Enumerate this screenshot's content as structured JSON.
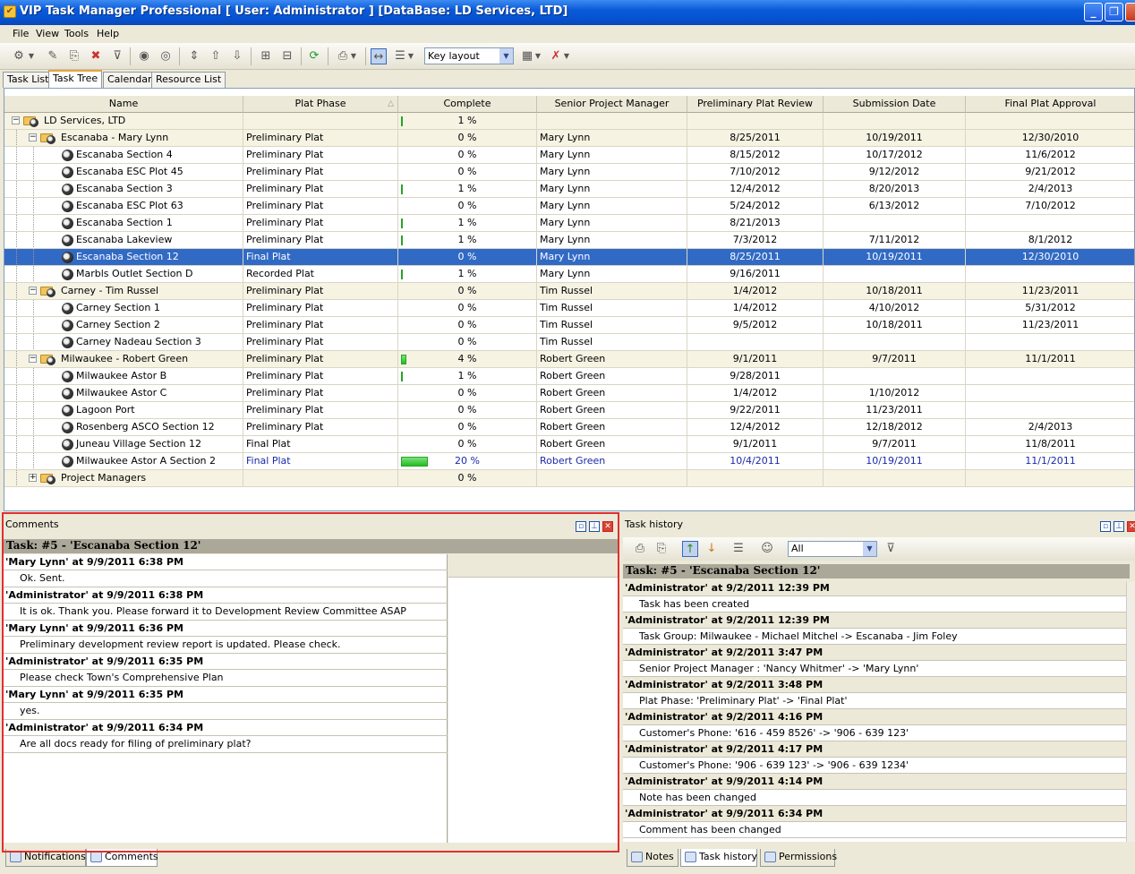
{
  "window": {
    "title": "VIP Task Manager Professional [ User: Administrator ] [DataBase: LD Services, LTD]"
  },
  "menu": [
    "File",
    "View",
    "Tools",
    "Help"
  ],
  "toolbar": {
    "layout_value": "Key layout"
  },
  "tabs": [
    "Task List",
    "Task Tree",
    "Calendar",
    "Resource List"
  ],
  "active_tab": "Task Tree",
  "grid": {
    "columns": [
      "Name",
      "Plat Phase",
      "Complete",
      "Senior Project Manager",
      "Preliminary Plat Review",
      "Submission Date",
      "Final Plat Approval"
    ],
    "rows": [
      {
        "level": 0,
        "type": "group",
        "expanded": true,
        "name": "LD Services, LTD",
        "phase": "",
        "complete": "1 %",
        "progress": 0.01,
        "manager": "",
        "review": "",
        "submission": "",
        "approval": ""
      },
      {
        "level": 1,
        "type": "group",
        "expanded": true,
        "name": "Escanaba - Mary Lynn",
        "phase": "Preliminary Plat",
        "complete": "0 %",
        "progress": 0,
        "manager": "Mary Lynn",
        "review": "8/25/2011",
        "submission": "10/19/2011",
        "approval": "12/30/2010"
      },
      {
        "level": 2,
        "type": "task",
        "name": "Escanaba Section 4",
        "phase": "Preliminary Plat",
        "complete": "0 %",
        "progress": 0,
        "manager": "Mary Lynn",
        "review": "8/15/2012",
        "submission": "10/17/2012",
        "approval": "11/6/2012"
      },
      {
        "level": 2,
        "type": "task",
        "name": "Escanaba ESC Plot 45",
        "phase": "Preliminary Plat",
        "complete": "0 %",
        "progress": 0,
        "manager": "Mary Lynn",
        "review": "7/10/2012",
        "submission": "9/12/2012",
        "approval": "9/21/2012"
      },
      {
        "level": 2,
        "type": "task",
        "name": "Escanaba Section 3",
        "phase": "Preliminary Plat",
        "complete": "1 %",
        "progress": 0.01,
        "manager": "Mary Lynn",
        "review": "12/4/2012",
        "submission": "8/20/2013",
        "approval": "2/4/2013"
      },
      {
        "level": 2,
        "type": "task",
        "name": "Escanaba ESC Plot 63",
        "phase": "Preliminary Plat",
        "complete": "0 %",
        "progress": 0,
        "manager": "Mary Lynn",
        "review": "5/24/2012",
        "submission": "6/13/2012",
        "approval": "7/10/2012"
      },
      {
        "level": 2,
        "type": "task",
        "name": "Escanaba Section 1",
        "phase": "Preliminary Plat",
        "complete": "1 %",
        "progress": 0.01,
        "manager": "Mary Lynn",
        "review": "8/21/2013",
        "submission": "",
        "approval": ""
      },
      {
        "level": 2,
        "type": "task",
        "name": "Escanaba Lakeview",
        "phase": "Preliminary Plat",
        "complete": "1 %",
        "progress": 0.01,
        "manager": "Mary Lynn",
        "review": "7/3/2012",
        "submission": "7/11/2012",
        "approval": "8/1/2012"
      },
      {
        "level": 2,
        "type": "task",
        "selected": true,
        "name": "Escanaba Section 12",
        "phase": "Final Plat",
        "complete": "0 %",
        "progress": 0,
        "manager": "Mary Lynn",
        "review": "8/25/2011",
        "submission": "10/19/2011",
        "approval": "12/30/2010"
      },
      {
        "level": 2,
        "type": "task",
        "name": "Marbls Outlet Section D",
        "phase": "Recorded Plat",
        "complete": "1 %",
        "progress": 0.01,
        "manager": "Mary Lynn",
        "review": "9/16/2011",
        "submission": "",
        "approval": ""
      },
      {
        "level": 1,
        "type": "group",
        "expanded": true,
        "name": "Carney - Tim Russel",
        "phase": "Preliminary Plat",
        "complete": "0 %",
        "progress": 0,
        "manager": "Tim Russel",
        "review": "1/4/2012",
        "submission": "10/18/2011",
        "approval": "11/23/2011"
      },
      {
        "level": 2,
        "type": "task",
        "name": "Carney Section 1",
        "phase": "Preliminary Plat",
        "complete": "0 %",
        "progress": 0,
        "manager": "Tim Russel",
        "review": "1/4/2012",
        "submission": "4/10/2012",
        "approval": "5/31/2012"
      },
      {
        "level": 2,
        "type": "task",
        "name": "Carney Section 2",
        "phase": "Preliminary Plat",
        "complete": "0 %",
        "progress": 0,
        "manager": "Tim Russel",
        "review": "9/5/2012",
        "submission": "10/18/2011",
        "approval": "11/23/2011"
      },
      {
        "level": 2,
        "type": "task",
        "name": "Carney Nadeau Section 3",
        "phase": "Preliminary Plat",
        "complete": "0 %",
        "progress": 0,
        "manager": "Tim Russel",
        "review": "",
        "submission": "",
        "approval": ""
      },
      {
        "level": 1,
        "type": "group",
        "expanded": true,
        "name": "Milwaukee - Robert Green",
        "phase": "Preliminary Plat",
        "complete": "4 %",
        "progress": 0.04,
        "manager": "Robert Green",
        "review": "9/1/2011",
        "submission": "9/7/2011",
        "approval": "11/1/2011"
      },
      {
        "level": 2,
        "type": "task",
        "name": "Milwaukee Astor B",
        "phase": "Preliminary Plat",
        "complete": "1 %",
        "progress": 0.01,
        "manager": "Robert Green",
        "review": "9/28/2011",
        "submission": "",
        "approval": ""
      },
      {
        "level": 2,
        "type": "task",
        "name": "Milwaukee Astor C",
        "phase": "Preliminary Plat",
        "complete": "0 %",
        "progress": 0,
        "manager": "Robert Green",
        "review": "1/4/2012",
        "submission": "1/10/2012",
        "approval": ""
      },
      {
        "level": 2,
        "type": "task",
        "name": "Lagoon Port",
        "phase": "Preliminary Plat",
        "complete": "0 %",
        "progress": 0,
        "manager": "Robert Green",
        "review": "9/22/2011",
        "submission": "11/23/2011",
        "approval": ""
      },
      {
        "level": 2,
        "type": "task",
        "name": "Rosenberg ASCO Section 12",
        "phase": "Preliminary Plat",
        "complete": "0 %",
        "progress": 0,
        "manager": "Robert Green",
        "review": "12/4/2012",
        "submission": "12/18/2012",
        "approval": "2/4/2013"
      },
      {
        "level": 2,
        "type": "task",
        "name": "Juneau Village Section 12",
        "phase": "Final Plat",
        "complete": "0 %",
        "progress": 0,
        "manager": "Robert Green",
        "review": "9/1/2011",
        "submission": "9/7/2011",
        "approval": "11/8/2011"
      },
      {
        "level": 2,
        "type": "task",
        "highlight": true,
        "name": "Milwaukee  Astor A Section 2",
        "phase": "Final Plat",
        "complete": "20 %",
        "progress": 0.2,
        "manager": "Robert Green",
        "review": "10/4/2011",
        "submission": "10/19/2011",
        "approval": "11/1/2011"
      },
      {
        "level": 1,
        "type": "group",
        "expanded": false,
        "name": "Project Managers",
        "phase": "",
        "complete": "0 %",
        "progress": 0,
        "manager": "",
        "review": "",
        "submission": "",
        "approval": ""
      }
    ]
  },
  "comments": {
    "title": "Comments",
    "task_header": "Task: #5 - 'Escanaba Section 12'",
    "entries": [
      {
        "head": "'Mary Lynn' at 9/9/2011 6:38 PM",
        "body": "Ok. Sent."
      },
      {
        "head": "'Administrator' at 9/9/2011 6:38 PM",
        "body": "It is ok. Thank you. Please forward it to Development Review Committee ASAP"
      },
      {
        "head": "'Mary Lynn' at 9/9/2011 6:36 PM",
        "body": "Preliminary development review report is updated. Please check."
      },
      {
        "head": "'Administrator' at 9/9/2011 6:35 PM",
        "body": "Please check Town's Comprehensive Plan"
      },
      {
        "head": "'Mary Lynn' at 9/9/2011 6:35 PM",
        "body": "yes."
      },
      {
        "head": "'Administrator' at 9/9/2011 6:34 PM",
        "body": "Are all docs ready for filing of preliminary plat?"
      }
    ]
  },
  "history": {
    "title": "Task history",
    "filter_value": "All",
    "task_header": "Task: #5 - 'Escanaba Section 12'",
    "entries": [
      {
        "head": "'Administrator' at 9/2/2011 12:39 PM",
        "body": "Task has been created"
      },
      {
        "head": "'Administrator' at 9/2/2011 12:39 PM",
        "body": "Task Group: Milwaukee - Michael Mitchel -> Escanaba - Jim Foley"
      },
      {
        "head": "'Administrator' at 9/2/2011 3:47 PM",
        "body": "Senior Project Manager : 'Nancy Whitmer' -> 'Mary Lynn'"
      },
      {
        "head": "'Administrator' at 9/2/2011 3:48 PM",
        "body": "Plat Phase: 'Preliminary Plat' -> 'Final Plat'"
      },
      {
        "head": "'Administrator' at 9/2/2011 4:16 PM",
        "body": "Customer's Phone: '616 - 459 8526' -> '906 - 639 123'"
      },
      {
        "head": "'Administrator' at 9/2/2011 4:17 PM",
        "body": "Customer's Phone: '906 - 639 123' -> '906 - 639 1234'"
      },
      {
        "head": "'Administrator' at 9/9/2011 4:14 PM",
        "body": "Note has been changed"
      },
      {
        "head": "'Administrator' at 9/9/2011 6:34 PM",
        "body": "Comment has been changed"
      }
    ]
  },
  "bottom_tabs_left": [
    "Notifications",
    "Comments"
  ],
  "bottom_tabs_right": [
    "Notes",
    "Task history",
    "Permissions"
  ]
}
